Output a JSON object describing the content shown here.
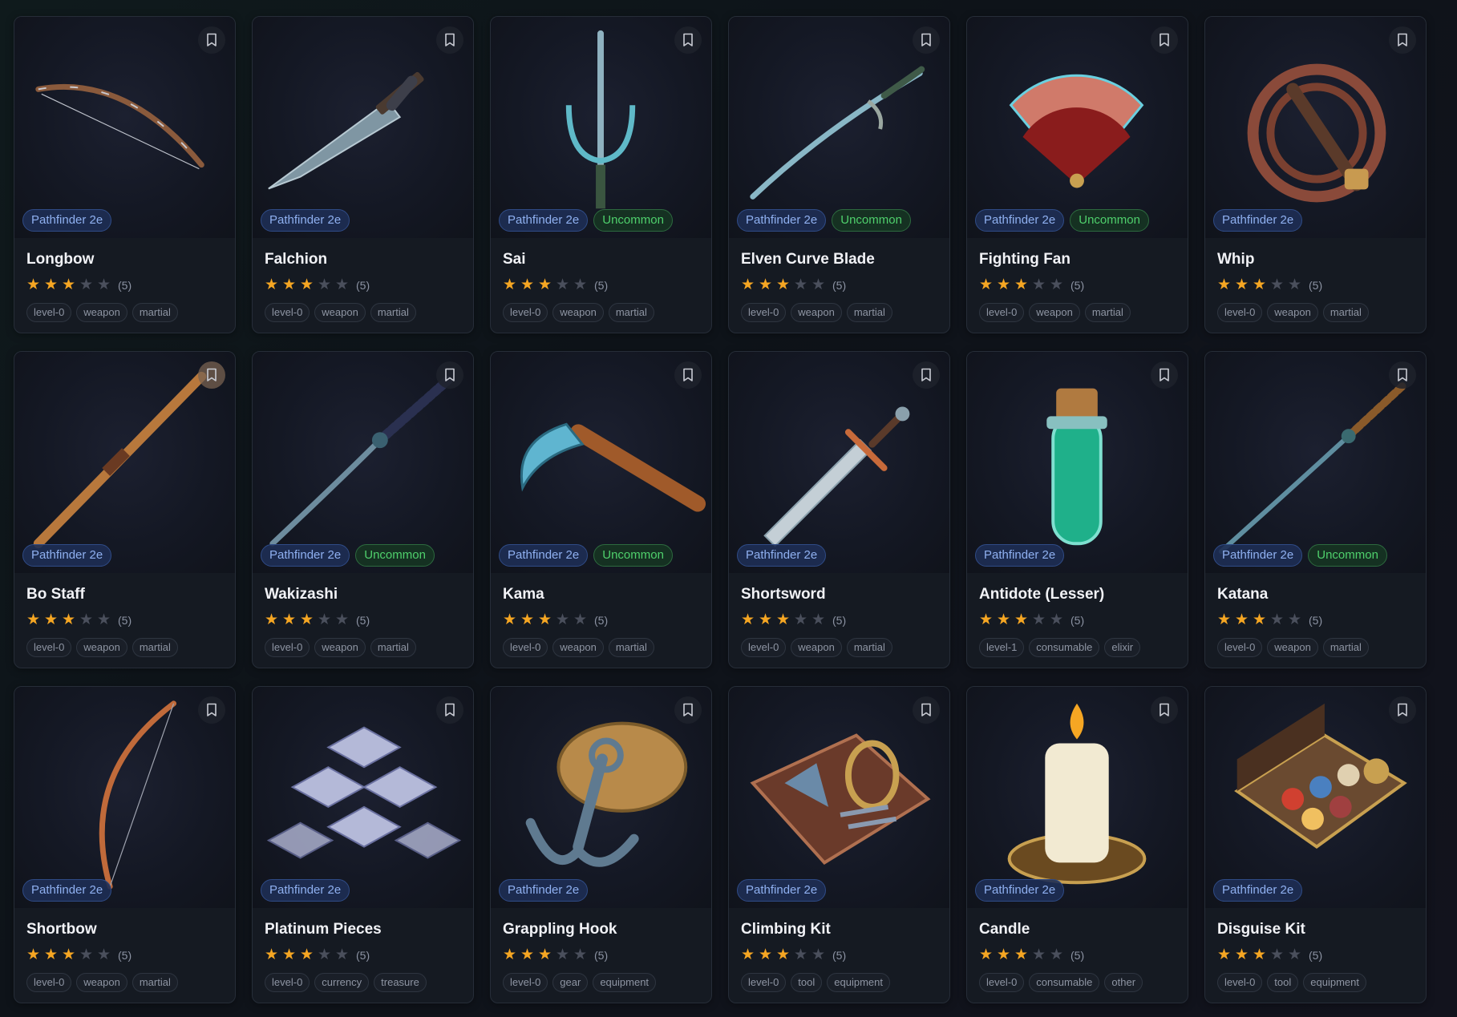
{
  "colors": {
    "background": "#0e1319",
    "card": "#151a22",
    "system_badge": "#8fb0f0",
    "uncommon_badge": "#4fd06c",
    "star_on": "#f5a623",
    "star_off": "#4a4f5c"
  },
  "cards": [
    {
      "name": "Longbow",
      "icon": "longbow-icon",
      "system": "Pathfinder 2e",
      "rarity": "",
      "stars": 3,
      "rating_count": "(5)",
      "tags": [
        "level-0",
        "weapon",
        "martial"
      ],
      "bookmarked": false
    },
    {
      "name": "Falchion",
      "icon": "falchion-icon",
      "system": "Pathfinder 2e",
      "rarity": "",
      "stars": 3,
      "rating_count": "(5)",
      "tags": [
        "level-0",
        "weapon",
        "martial"
      ],
      "bookmarked": false
    },
    {
      "name": "Sai",
      "icon": "sai-icon",
      "system": "Pathfinder 2e",
      "rarity": "Uncommon",
      "stars": 3,
      "rating_count": "(5)",
      "tags": [
        "level-0",
        "weapon",
        "martial"
      ],
      "bookmarked": false
    },
    {
      "name": "Elven Curve Blade",
      "icon": "curve-blade-icon",
      "system": "Pathfinder 2e",
      "rarity": "Uncommon",
      "stars": 3,
      "rating_count": "(5)",
      "tags": [
        "level-0",
        "weapon",
        "martial"
      ],
      "bookmarked": false
    },
    {
      "name": "Fighting Fan",
      "icon": "fighting-fan-icon",
      "system": "Pathfinder 2e",
      "rarity": "Uncommon",
      "stars": 3,
      "rating_count": "(5)",
      "tags": [
        "level-0",
        "weapon",
        "martial"
      ],
      "bookmarked": false
    },
    {
      "name": "Whip",
      "icon": "whip-icon",
      "system": "Pathfinder 2e",
      "rarity": "",
      "stars": 3,
      "rating_count": "(5)",
      "tags": [
        "level-0",
        "weapon",
        "martial"
      ],
      "bookmarked": false
    },
    {
      "name": "Bo Staff",
      "icon": "bo-staff-icon",
      "system": "Pathfinder 2e",
      "rarity": "",
      "stars": 3,
      "rating_count": "(5)",
      "tags": [
        "level-0",
        "weapon",
        "martial"
      ],
      "bookmarked": true
    },
    {
      "name": "Wakizashi",
      "icon": "wakizashi-icon",
      "system": "Pathfinder 2e",
      "rarity": "Uncommon",
      "stars": 3,
      "rating_count": "(5)",
      "tags": [
        "level-0",
        "weapon",
        "martial"
      ],
      "bookmarked": false
    },
    {
      "name": "Kama",
      "icon": "kama-icon",
      "system": "Pathfinder 2e",
      "rarity": "Uncommon",
      "stars": 3,
      "rating_count": "(5)",
      "tags": [
        "level-0",
        "weapon",
        "martial"
      ],
      "bookmarked": false
    },
    {
      "name": "Shortsword",
      "icon": "shortsword-icon",
      "system": "Pathfinder 2e",
      "rarity": "",
      "stars": 3,
      "rating_count": "(5)",
      "tags": [
        "level-0",
        "weapon",
        "martial"
      ],
      "bookmarked": false
    },
    {
      "name": "Antidote (Lesser)",
      "icon": "potion-icon",
      "system": "Pathfinder 2e",
      "rarity": "",
      "stars": 3,
      "rating_count": "(5)",
      "tags": [
        "level-1",
        "consumable",
        "elixir"
      ],
      "bookmarked": false
    },
    {
      "name": "Katana",
      "icon": "katana-icon",
      "system": "Pathfinder 2e",
      "rarity": "Uncommon",
      "stars": 3,
      "rating_count": "(5)",
      "tags": [
        "level-0",
        "weapon",
        "martial"
      ],
      "bookmarked": false
    },
    {
      "name": "Shortbow",
      "icon": "shortbow-icon",
      "system": "Pathfinder 2e",
      "rarity": "",
      "stars": 3,
      "rating_count": "(5)",
      "tags": [
        "level-0",
        "weapon",
        "martial"
      ],
      "bookmarked": false
    },
    {
      "name": "Platinum Pieces",
      "icon": "platinum-ingots-icon",
      "system": "Pathfinder 2e",
      "rarity": "",
      "stars": 3,
      "rating_count": "(5)",
      "tags": [
        "level-0",
        "currency",
        "treasure"
      ],
      "bookmarked": false
    },
    {
      "name": "Grappling Hook",
      "icon": "grappling-hook-icon",
      "system": "Pathfinder 2e",
      "rarity": "",
      "stars": 3,
      "rating_count": "(5)",
      "tags": [
        "level-0",
        "gear",
        "equipment"
      ],
      "bookmarked": false
    },
    {
      "name": "Climbing Kit",
      "icon": "climbing-kit-icon",
      "system": "Pathfinder 2e",
      "rarity": "",
      "stars": 3,
      "rating_count": "(5)",
      "tags": [
        "level-0",
        "tool",
        "equipment"
      ],
      "bookmarked": false
    },
    {
      "name": "Candle",
      "icon": "candle-icon",
      "system": "Pathfinder 2e",
      "rarity": "",
      "stars": 3,
      "rating_count": "(5)",
      "tags": [
        "level-0",
        "consumable",
        "other"
      ],
      "bookmarked": false
    },
    {
      "name": "Disguise Kit",
      "icon": "disguise-kit-icon",
      "system": "Pathfinder 2e",
      "rarity": "",
      "stars": 3,
      "rating_count": "(5)",
      "tags": [
        "level-0",
        "tool",
        "equipment"
      ],
      "bookmarked": false
    }
  ]
}
